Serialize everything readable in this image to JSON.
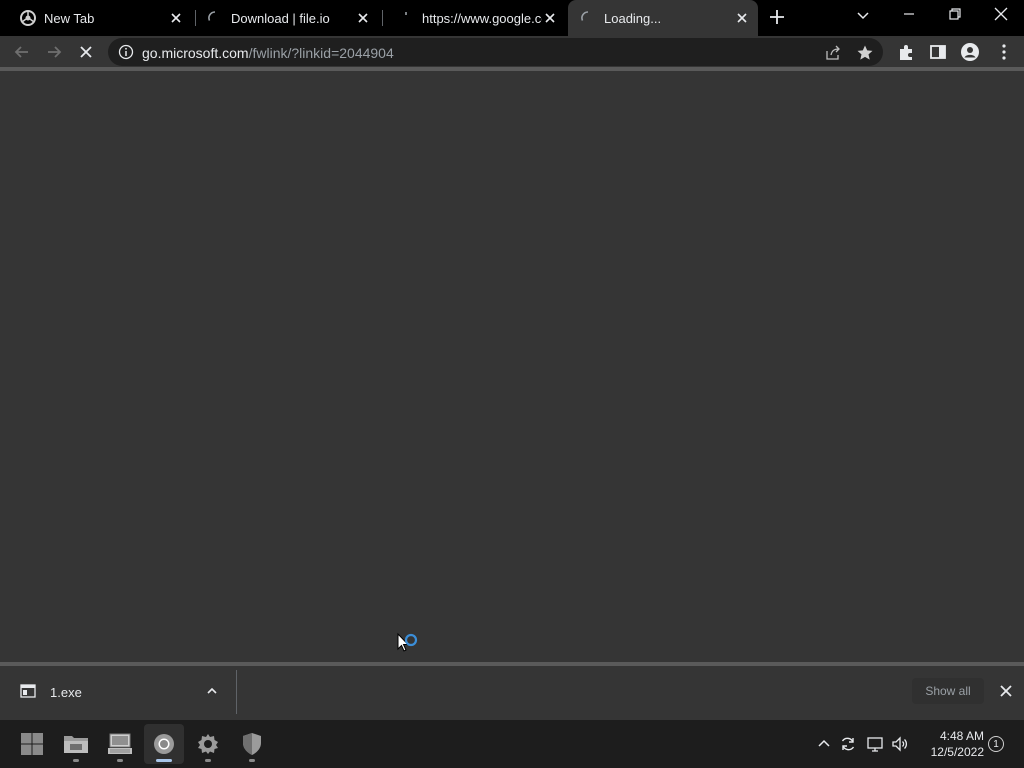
{
  "browser": {
    "tabs": [
      {
        "title": "New Tab",
        "favicon": "chrome-icon",
        "state": "inactive"
      },
      {
        "title": "Download | file.io",
        "favicon": "loading-spinner-icon",
        "state": "inactive"
      },
      {
        "title": "https://www.google.co",
        "favicon": "loading-spinner-icon",
        "state": "inactive"
      },
      {
        "title": "Loading...",
        "favicon": "loading-spinner-icon",
        "state": "active"
      }
    ],
    "address_bar": {
      "host": "go.microsoft.com",
      "path": "/fwlink/?linkid=2044904"
    }
  },
  "download_shelf": {
    "items": [
      {
        "filename": "1.exe"
      }
    ],
    "show_all_label": "Show all"
  },
  "taskbar": {
    "apps": [
      "start-icon",
      "file-explorer-icon",
      "control-panel-icon",
      "chrome-icon",
      "settings-icon",
      "windows-security-icon"
    ],
    "clock": {
      "time": "4:48 AM",
      "date": "12/5/2022"
    },
    "notification_count": "1"
  },
  "colors": {
    "tabstrip_bg": "#000000",
    "toolbar_bg": "#353535",
    "omnibox_bg": "#1f1f1f",
    "taskbar_bg": "#1d1d1d",
    "spinner_blue": "#3b8ed8"
  }
}
